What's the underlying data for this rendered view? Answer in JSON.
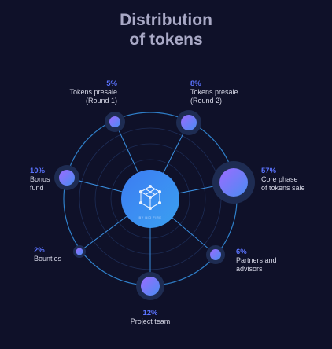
{
  "title_line1": "Distribution",
  "title_line2": "of tokens",
  "hub": {
    "caption": "BY BIO FIRE",
    "icon": "network-cube-icon"
  },
  "segments": [
    {
      "id": "presale-1",
      "percent": "5%",
      "line1": "Tokens presale",
      "line2": "(Round 1)"
    },
    {
      "id": "presale-2",
      "percent": "8%",
      "line1": "Tokens presale",
      "line2": "(Round 2)"
    },
    {
      "id": "core",
      "percent": "57%",
      "line1": "Core phase",
      "line2": "of tokens sale"
    },
    {
      "id": "partners",
      "percent": "6%",
      "line1": "Partners and",
      "line2": "advisors"
    },
    {
      "id": "team",
      "percent": "12%",
      "line1": "Project team",
      "line2": ""
    },
    {
      "id": "bounties",
      "percent": "2%",
      "line1": "Bounties",
      "line2": ""
    },
    {
      "id": "bonus",
      "percent": "10%",
      "line1": "Bonus",
      "line2": "fund"
    }
  ],
  "colors": {
    "background": "#0f1129",
    "title": "#a9a9c6",
    "percent": "#5b74ff",
    "ring": "#2f7fc9",
    "node_from": "#8b5cf6",
    "node_to": "#4b8cf0"
  }
}
